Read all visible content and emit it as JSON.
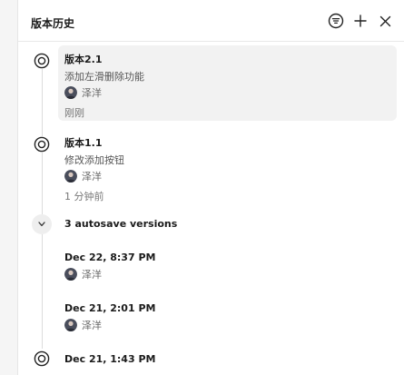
{
  "panel": {
    "title": "版本历史",
    "header_icons": [
      "filter-icon",
      "plus-icon",
      "close-icon"
    ]
  },
  "versions": [
    {
      "title": "版本2.1",
      "description": "添加左滑删除功能",
      "author": "泽洋",
      "time": "刚刚",
      "selected": true
    },
    {
      "title": "版本1.1",
      "description": "修改添加按钮",
      "author": "泽洋",
      "time": "1 分钟前",
      "selected": false
    }
  ],
  "autosave_group": {
    "label": "3 autosave versions",
    "expanded": true,
    "items": [
      {
        "date": "Dec 22, 8:37 PM",
        "author": "泽洋"
      },
      {
        "date": "Dec 21, 2:01 PM",
        "author": "泽洋"
      }
    ]
  },
  "last_version": {
    "date": "Dec 21, 1:43 PM"
  },
  "colors": {
    "selected_bg": "#f2f2f2",
    "timeline": "#dcdcdc",
    "text_primary": "#1b1b1b",
    "text_secondary": "#666666"
  }
}
